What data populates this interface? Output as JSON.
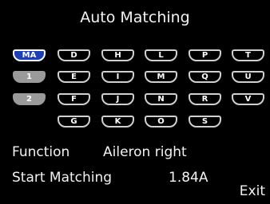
{
  "header": {
    "title": "Auto Matching"
  },
  "keys": {
    "MA": "MA",
    "m1": "1",
    "m2": "2",
    "D": "D",
    "E": "E",
    "F": "F",
    "G": "G",
    "H": "H",
    "I": "I",
    "J": "J",
    "K": "K",
    "L": "L",
    "M": "M",
    "N": "N",
    "O": "O",
    "P": "P",
    "Q": "Q",
    "R": "R",
    "S": "S",
    "T": "T",
    "U": "U",
    "V": "V"
  },
  "info": {
    "function_label": "Function",
    "function_value": "Aileron right",
    "start_label": "Start Matching",
    "current_value": "1.84A",
    "exit_label": "Exit"
  },
  "colors": {
    "background": "#000000",
    "active_key": "#1d3fb0",
    "mode_key": "#9a9a9a"
  }
}
